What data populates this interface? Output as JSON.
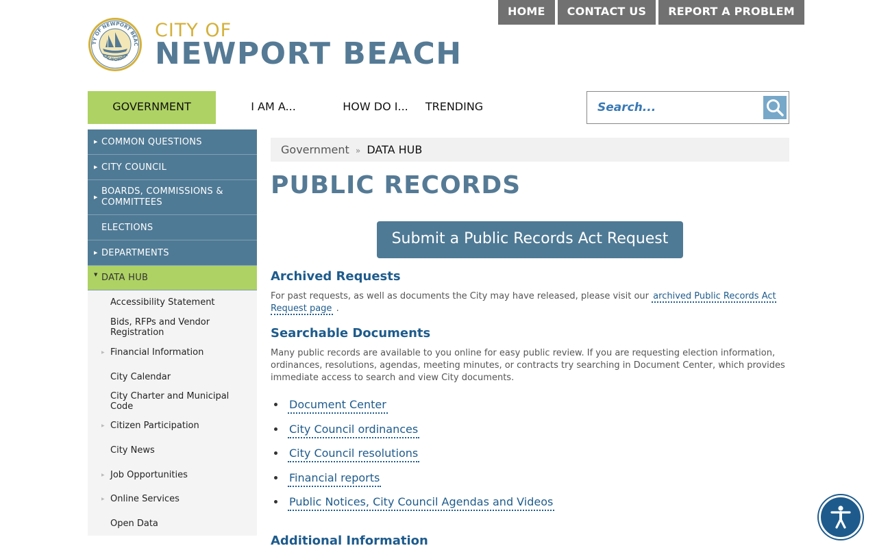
{
  "top_nav": [
    "HOME",
    "CONTACT US",
    "REPORT A PROBLEM"
  ],
  "logo": {
    "city_of": "CITY OF",
    "name": "NEWPORT BEACH",
    "seal_top": "CITY OF NEWPORT BEACH",
    "seal_bottom": "CALIFORNIA"
  },
  "main_nav": [
    "GOVERNMENT",
    "I AM A...",
    "HOW DO I...",
    "TRENDING"
  ],
  "search": {
    "placeholder": "Search..."
  },
  "sidebar": {
    "items": [
      "COMMON QUESTIONS",
      "CITY COUNCIL",
      "BOARDS, COMMISSIONS & COMMITTEES",
      "ELECTIONS",
      "DEPARTMENTS",
      "DATA HUB"
    ],
    "sub_items": [
      "Accessibility Statement",
      "Bids, RFPs and Vendor Registration",
      "Financial Information",
      "City Calendar",
      "City Charter and Municipal Code",
      "Citizen Participation",
      "City News",
      "Job Opportunities",
      "Online Services",
      "Open Data"
    ]
  },
  "breadcrumb": {
    "parent": "Government",
    "separator": "»",
    "current": "DATA HUB"
  },
  "page_title": "PUBLIC RECORDS",
  "cta_label": "Submit a Public Records Act Request",
  "archived": {
    "heading": "Archived Requests",
    "text_before": "For past requests, as well as documents the City may have released, please visit our",
    "link": "archived Public Records Act Request page",
    "text_after": "."
  },
  "searchable": {
    "heading": "Searchable Documents",
    "text": "Many public records are available to you online for easy public review. If you are requesting election information, ordinances, resolutions, agendas, meeting minutes, or contracts try searching in Document Center, which provides immediate access to search and view City documents.",
    "links": [
      "Document Center",
      "City Council ordinances",
      "City Council resolutions",
      "Financial reports",
      "Public Notices, City Council Agendas and Videos"
    ]
  },
  "additional_heading": "Additional Information",
  "colors": {
    "accent_green": "#aed263",
    "nav_blue": "#4f7a95",
    "title_blue": "#557a95",
    "gold": "#d4b13c",
    "link_blue": "#1e5b8c"
  }
}
